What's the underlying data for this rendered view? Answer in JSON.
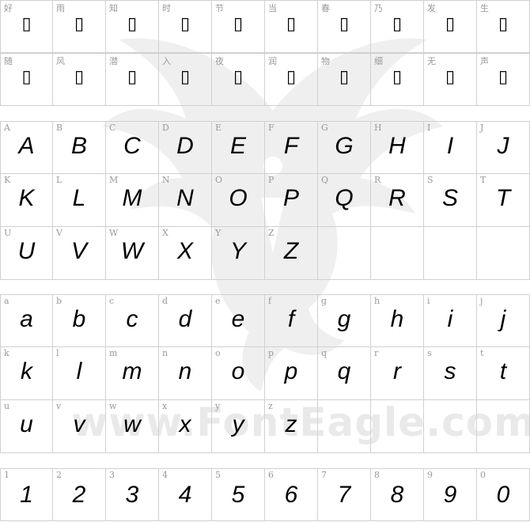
{
  "watermark": {
    "text": "www.FontEagle.com"
  },
  "cjk_rows": [
    [
      {
        "label": "好",
        "glyph": "▯"
      },
      {
        "label": "雨",
        "glyph": "▯"
      },
      {
        "label": "知",
        "glyph": "▯"
      },
      {
        "label": "时",
        "glyph": "▯"
      },
      {
        "label": "节",
        "glyph": "▯"
      },
      {
        "label": "当",
        "glyph": "▯"
      },
      {
        "label": "春",
        "glyph": "▯"
      },
      {
        "label": "乃",
        "glyph": "▯"
      },
      {
        "label": "发",
        "glyph": "▯"
      },
      {
        "label": "生",
        "glyph": "▯"
      }
    ],
    [
      {
        "label": "随",
        "glyph": "▯"
      },
      {
        "label": "风",
        "glyph": "▯"
      },
      {
        "label": "潜",
        "glyph": "▯"
      },
      {
        "label": "入",
        "glyph": "▯"
      },
      {
        "label": "夜",
        "glyph": "▯"
      },
      {
        "label": "润",
        "glyph": "▯"
      },
      {
        "label": "物",
        "glyph": "▯"
      },
      {
        "label": "细",
        "glyph": "▯"
      },
      {
        "label": "无",
        "glyph": "▯"
      },
      {
        "label": "声",
        "glyph": "▯"
      }
    ]
  ],
  "upper_rows": [
    [
      {
        "label": "A",
        "glyph": "A"
      },
      {
        "label": "B",
        "glyph": "B"
      },
      {
        "label": "C",
        "glyph": "C"
      },
      {
        "label": "D",
        "glyph": "D"
      },
      {
        "label": "E",
        "glyph": "E"
      },
      {
        "label": "F",
        "glyph": "F"
      },
      {
        "label": "G",
        "glyph": "G"
      },
      {
        "label": "H",
        "glyph": "H"
      },
      {
        "label": "I",
        "glyph": "I"
      },
      {
        "label": "J",
        "glyph": "J"
      }
    ],
    [
      {
        "label": "K",
        "glyph": "K"
      },
      {
        "label": "L",
        "glyph": "L"
      },
      {
        "label": "M",
        "glyph": "M"
      },
      {
        "label": "N",
        "glyph": "N"
      },
      {
        "label": "O",
        "glyph": "O"
      },
      {
        "label": "P",
        "glyph": "P"
      },
      {
        "label": "Q",
        "glyph": "Q"
      },
      {
        "label": "R",
        "glyph": "R"
      },
      {
        "label": "S",
        "glyph": "S"
      },
      {
        "label": "T",
        "glyph": "T"
      }
    ],
    [
      {
        "label": "U",
        "glyph": "U"
      },
      {
        "label": "V",
        "glyph": "V"
      },
      {
        "label": "W",
        "glyph": "W"
      },
      {
        "label": "X",
        "glyph": "X"
      },
      {
        "label": "Y",
        "glyph": "Y"
      },
      {
        "label": "Z",
        "glyph": "Z"
      },
      {
        "label": "",
        "glyph": ""
      },
      {
        "label": "",
        "glyph": ""
      },
      {
        "label": "",
        "glyph": ""
      },
      {
        "label": "",
        "glyph": ""
      }
    ]
  ],
  "lower_rows": [
    [
      {
        "label": "a",
        "glyph": "a"
      },
      {
        "label": "b",
        "glyph": "b"
      },
      {
        "label": "c",
        "glyph": "c"
      },
      {
        "label": "d",
        "glyph": "d"
      },
      {
        "label": "e",
        "glyph": "e"
      },
      {
        "label": "f",
        "glyph": "f"
      },
      {
        "label": "g",
        "glyph": "g"
      },
      {
        "label": "h",
        "glyph": "h"
      },
      {
        "label": "i",
        "glyph": "i"
      },
      {
        "label": "j",
        "glyph": "j"
      }
    ],
    [
      {
        "label": "k",
        "glyph": "k"
      },
      {
        "label": "l",
        "glyph": "l"
      },
      {
        "label": "m",
        "glyph": "m"
      },
      {
        "label": "n",
        "glyph": "n"
      },
      {
        "label": "o",
        "glyph": "o"
      },
      {
        "label": "p",
        "glyph": "p"
      },
      {
        "label": "q",
        "glyph": "q"
      },
      {
        "label": "r",
        "glyph": "r"
      },
      {
        "label": "s",
        "glyph": "s"
      },
      {
        "label": "t",
        "glyph": "t"
      }
    ],
    [
      {
        "label": "u",
        "glyph": "u"
      },
      {
        "label": "v",
        "glyph": "v"
      },
      {
        "label": "w",
        "glyph": "w"
      },
      {
        "label": "x",
        "glyph": "x"
      },
      {
        "label": "y",
        "glyph": "y"
      },
      {
        "label": "z",
        "glyph": "z"
      },
      {
        "label": "",
        "glyph": ""
      },
      {
        "label": "",
        "glyph": ""
      },
      {
        "label": "",
        "glyph": ""
      },
      {
        "label": "",
        "glyph": ""
      }
    ]
  ],
  "digit_rows": [
    [
      {
        "label": "1",
        "glyph": "1"
      },
      {
        "label": "2",
        "glyph": "2"
      },
      {
        "label": "3",
        "glyph": "3"
      },
      {
        "label": "4",
        "glyph": "4"
      },
      {
        "label": "5",
        "glyph": "5"
      },
      {
        "label": "6",
        "glyph": "6"
      },
      {
        "label": "7",
        "glyph": "7"
      },
      {
        "label": "8",
        "glyph": "8"
      },
      {
        "label": "9",
        "glyph": "9"
      },
      {
        "label": "0",
        "glyph": "0"
      }
    ]
  ]
}
